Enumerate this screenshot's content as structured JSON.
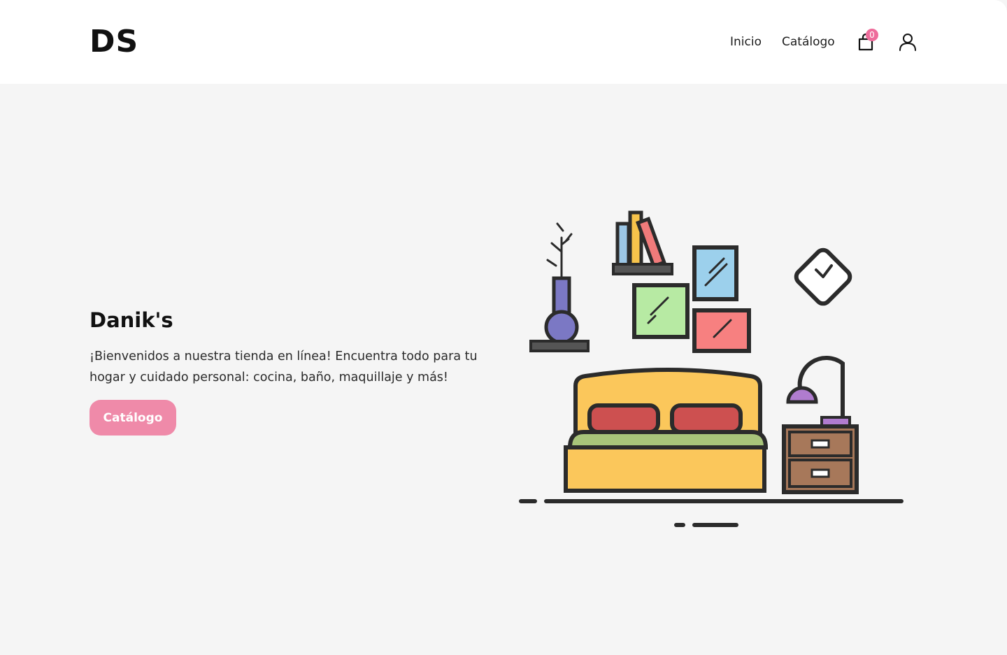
{
  "header": {
    "logo": "DS",
    "nav": [
      {
        "label": "Inicio"
      },
      {
        "label": "Catálogo"
      }
    ],
    "cart": {
      "count": "0",
      "icon": "shopping-bag-icon"
    },
    "user": {
      "icon": "user-icon"
    }
  },
  "hero": {
    "title": "Danik's",
    "description": "¡Bienvenidos a nuestra tienda en línea! Encuentra todo para tu hogar y cuidado personal: cocina, baño, maquillaje y más!",
    "button_label": "Catálogo"
  },
  "colors": {
    "accent": "#ef8aa9",
    "badge": "#ee6c9b",
    "background": "#f5f5f5",
    "header_bg": "#ffffff"
  }
}
